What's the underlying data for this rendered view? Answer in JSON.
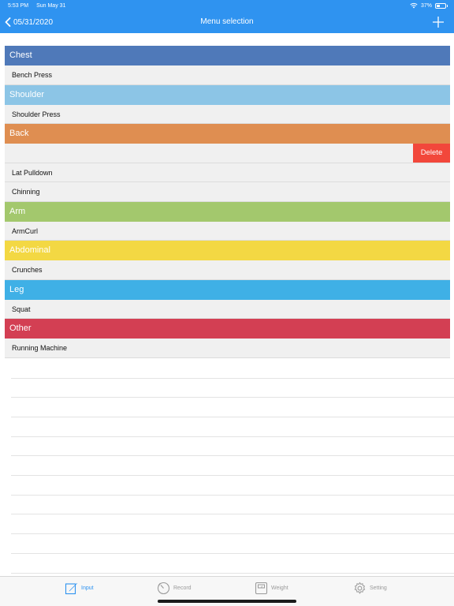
{
  "status_bar": {
    "time": "5:53 PM",
    "date": "Sun May 31",
    "battery": "37%"
  },
  "nav": {
    "back_label": "05/31/2020",
    "title": "Menu selection"
  },
  "sections": [
    {
      "name": "Chest",
      "color": "#4f79b9",
      "items": [
        "Bench Press"
      ]
    },
    {
      "name": "Shoulder",
      "color": "#8cc5e6",
      "items": [
        "Shoulder Press"
      ]
    },
    {
      "name": "Back",
      "color": "#df8e51",
      "items": [
        "",
        "Lat Pulldown",
        "Chinning"
      ]
    },
    {
      "name": "Arm",
      "color": "#a3c86d",
      "items": [
        "ArmCurl"
      ]
    },
    {
      "name": "Abdominal",
      "color": "#f3d843",
      "items": [
        "Crunches"
      ]
    },
    {
      "name": "Leg",
      "color": "#3fb0e6",
      "items": [
        "Squat"
      ]
    },
    {
      "name": "Other",
      "color": "#d33f53",
      "items": [
        "Running Machine"
      ]
    }
  ],
  "delete_label": "Delete",
  "tabs": [
    {
      "label": "Input",
      "icon": "pencil-square-icon",
      "active": true
    },
    {
      "label": "Record",
      "icon": "clock-icon",
      "active": false
    },
    {
      "label": "Weight",
      "icon": "scale-icon",
      "active": false
    },
    {
      "label": "Setting",
      "icon": "gear-icon",
      "active": false
    }
  ]
}
